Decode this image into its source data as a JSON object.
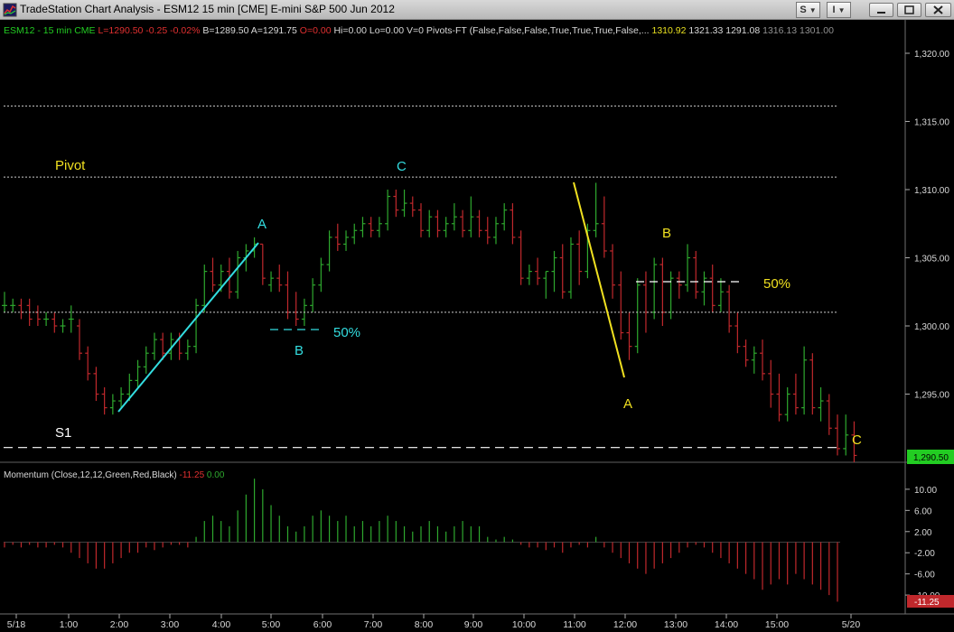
{
  "window": {
    "title": "TradeStation Chart Analysis - ESM12 15 min [CME] E-mini S&P 500 Jun 2012",
    "menu_buttons": [
      {
        "label": "S",
        "icon": "chevron-down-icon"
      },
      {
        "label": "I",
        "icon": "chevron-down-icon"
      }
    ],
    "controls": [
      "minimize-icon",
      "maximize-icon",
      "close-icon"
    ]
  },
  "colors": {
    "background": "#000000",
    "up_bar": "#2ea82e",
    "down_bar": "#c0282c",
    "cyan": "#33dde0",
    "yellow": "#f0e020",
    "axis_text": "#d8d8d8",
    "price_tag": "#22cc22"
  },
  "status_line": [
    {
      "text": "ESM12 - 15 min  CME",
      "color": "#22cc22"
    },
    {
      "text": "L=1290.50",
      "color": "#e03030"
    },
    {
      "text": "-0.25",
      "color": "#e03030"
    },
    {
      "text": "-0.02%",
      "color": "#e03030"
    },
    {
      "text": "B=1289.50",
      "color": "#d8d8d8"
    },
    {
      "text": "A=1291.75",
      "color": "#d8d8d8"
    },
    {
      "text": "O=0.00",
      "color": "#e03030"
    },
    {
      "text": "Hi=0.00",
      "color": "#d8d8d8"
    },
    {
      "text": "Lo=0.00",
      "color": "#d8d8d8"
    },
    {
      "text": "V=0",
      "color": "#d8d8d8"
    },
    {
      "text": "Pivots-FT (False,False,False,True,True,True,False,...",
      "color": "#d8d8d8"
    },
    {
      "text": "1310.92",
      "color": "#e8e020"
    },
    {
      "text": "1321.33",
      "color": "#d8d8d8"
    },
    {
      "text": "1291.08",
      "color": "#d8d8d8"
    },
    {
      "text": "1316.13",
      "color": "#909090"
    },
    {
      "text": "1301.00",
      "color": "#909090"
    }
  ],
  "indicator_line": [
    {
      "text": "Momentum (Close,12,12,Green,Red,Black)",
      "color": "#d8d8d8"
    },
    {
      "text": "-11.25",
      "color": "#e03030"
    },
    {
      "text": "0.00",
      "color": "#2ea82e"
    }
  ],
  "chart_data": [
    {
      "type": "ohlc",
      "x_ticks": [
        "5/18",
        "1:00",
        "2:00",
        "3:00",
        "4:00",
        "5:00",
        "6:00",
        "7:00",
        "8:00",
        "9:00",
        "10:00",
        "11:00",
        "12:00",
        "13:00",
        "14:00",
        "15:00",
        "5/20"
      ],
      "y_ticks": [
        "1,320.00",
        "1,315.00",
        "1,310.00",
        "1,305.00",
        "1,300.00",
        "1,295.00"
      ],
      "ylim": [
        1288,
        1323
      ],
      "last_price": "1,290.50",
      "bars": [
        [
          1301.5,
          1302.5,
          1301,
          1301.5
        ],
        [
          1301.5,
          1302,
          1301,
          1301.5
        ],
        [
          1301.5,
          1302,
          1300.5,
          1301
        ],
        [
          1301.5,
          1302,
          1300,
          1300.5
        ],
        [
          1301,
          1301.5,
          1300,
          1300.5
        ],
        [
          1300.5,
          1301,
          1300,
          1300.5
        ],
        [
          1300.5,
          1301,
          1299.5,
          1300
        ],
        [
          1300,
          1300.5,
          1299.5,
          1300
        ],
        [
          1300.5,
          1301.5,
          1299.5,
          1300.5
        ],
        [
          1300,
          1300.5,
          1297.5,
          1298
        ],
        [
          1298,
          1298.5,
          1296,
          1296.5
        ],
        [
          1296.5,
          1297,
          1294.5,
          1295
        ],
        [
          1295,
          1295.5,
          1293.5,
          1294
        ],
        [
          1294,
          1295,
          1293.5,
          1294.5
        ],
        [
          1294.5,
          1295.5,
          1294,
          1295
        ],
        [
          1295,
          1296.5,
          1294.5,
          1296
        ],
        [
          1296,
          1297.5,
          1295.5,
          1297
        ],
        [
          1297,
          1298.5,
          1296.5,
          1298
        ],
        [
          1298,
          1299.5,
          1297.5,
          1299
        ],
        [
          1299,
          1299.5,
          1297.5,
          1298
        ],
        [
          1298,
          1299.5,
          1297.5,
          1299
        ],
        [
          1299,
          1299.5,
          1297.5,
          1298
        ],
        [
          1298,
          1299,
          1297.5,
          1298.5
        ],
        [
          1298.5,
          1302,
          1298,
          1301.5
        ],
        [
          1301.5,
          1304.5,
          1301,
          1304
        ],
        [
          1304,
          1305,
          1302.5,
          1303
        ],
        [
          1303,
          1304.5,
          1302.5,
          1304
        ],
        [
          1304,
          1305,
          1302,
          1302.5
        ],
        [
          1302.5,
          1305.5,
          1302,
          1305
        ],
        [
          1305,
          1306,
          1304,
          1305.5
        ],
        [
          1305.5,
          1306.5,
          1305,
          1306
        ],
        [
          1306,
          1306,
          1303,
          1303.5
        ],
        [
          1303,
          1304,
          1302.5,
          1303.5
        ],
        [
          1303.5,
          1304.5,
          1302.5,
          1303
        ],
        [
          1303,
          1304,
          1300.5,
          1301
        ],
        [
          1301,
          1302.5,
          1300,
          1300.5
        ],
        [
          1300.5,
          1302,
          1300,
          1301.5
        ],
        [
          1301.5,
          1303.5,
          1301,
          1303
        ],
        [
          1303,
          1305,
          1302.5,
          1304.5
        ],
        [
          1304.5,
          1307,
          1304,
          1306.5
        ],
        [
          1306.5,
          1307.5,
          1305.5,
          1306
        ],
        [
          1306,
          1307,
          1305.5,
          1306.5
        ],
        [
          1306.5,
          1307.5,
          1306,
          1307
        ],
        [
          1307,
          1308,
          1306.5,
          1307.5
        ],
        [
          1307.5,
          1308,
          1306.5,
          1307
        ],
        [
          1307,
          1308,
          1306.5,
          1307.5
        ],
        [
          1307.5,
          1310,
          1307,
          1309.5
        ],
        [
          1309.5,
          1310,
          1308,
          1308.5
        ],
        [
          1308.5,
          1310,
          1308,
          1309
        ],
        [
          1309,
          1309.5,
          1308,
          1308.5
        ],
        [
          1308.5,
          1309,
          1306.5,
          1307
        ],
        [
          1307,
          1308.5,
          1306.5,
          1308
        ],
        [
          1308,
          1308.5,
          1306.5,
          1307
        ],
        [
          1307,
          1308,
          1306.5,
          1307.5
        ],
        [
          1307.5,
          1309,
          1307,
          1308
        ],
        [
          1308,
          1308.5,
          1306.5,
          1307
        ],
        [
          1307,
          1309.5,
          1306.5,
          1308
        ],
        [
          1308,
          1308.5,
          1306.5,
          1307
        ],
        [
          1307,
          1308,
          1306,
          1306.5
        ],
        [
          1306.5,
          1308,
          1306,
          1307.5
        ],
        [
          1307.5,
          1309,
          1307,
          1308.5
        ],
        [
          1308.5,
          1309,
          1306,
          1306.5
        ],
        [
          1306.5,
          1307,
          1303,
          1303.5
        ],
        [
          1303.5,
          1304.5,
          1303,
          1304
        ],
        [
          1304,
          1305,
          1303,
          1303.5
        ],
        [
          1303.5,
          1304,
          1302,
          1304
        ],
        [
          1304,
          1305.5,
          1302.5,
          1305
        ],
        [
          1305,
          1306,
          1302,
          1302.5
        ],
        [
          1302.5,
          1306.5,
          1302,
          1306
        ],
        [
          1306,
          1307,
          1303,
          1304
        ],
        [
          1304,
          1307.5,
          1303.5,
          1307
        ],
        [
          1307,
          1310.5,
          1306.5,
          1307.5
        ],
        [
          1307.5,
          1309.5,
          1305,
          1305.5
        ],
        [
          1305.5,
          1306,
          1302,
          1303
        ],
        [
          1303,
          1304,
          1299,
          1299.5
        ],
        [
          1299.5,
          1301,
          1297.5,
          1298.5
        ],
        [
          1298.5,
          1303.5,
          1298,
          1303
        ],
        [
          1303,
          1304,
          1299.5,
          1301
        ],
        [
          1301,
          1305,
          1300.5,
          1304.5
        ],
        [
          1304.5,
          1305,
          1300,
          1301
        ],
        [
          1301,
          1304,
          1300.5,
          1303.5
        ],
        [
          1303.5,
          1304,
          1302,
          1303
        ],
        [
          1303,
          1306,
          1302.5,
          1305
        ],
        [
          1305,
          1305.5,
          1302,
          1302.5
        ],
        [
          1302.5,
          1304,
          1301.5,
          1303.5
        ],
        [
          1303.5,
          1304.5,
          1301,
          1301.5
        ],
        [
          1301.5,
          1303.5,
          1301,
          1302.5
        ],
        [
          1302.5,
          1303,
          1299.5,
          1300
        ],
        [
          1300,
          1301,
          1298,
          1298.5
        ],
        [
          1298.5,
          1299,
          1297,
          1297.5
        ],
        [
          1297.5,
          1298.5,
          1296.5,
          1298
        ],
        [
          1298,
          1299,
          1296,
          1296.5
        ],
        [
          1296.5,
          1297.5,
          1294,
          1295
        ],
        [
          1295,
          1296.5,
          1293,
          1293.5
        ],
        [
          1293.5,
          1295.5,
          1293,
          1295
        ],
        [
          1295,
          1296.5,
          1293.5,
          1294
        ],
        [
          1294,
          1298.5,
          1293.5,
          1297.5
        ],
        [
          1297.5,
          1298,
          1293.5,
          1294
        ],
        [
          1294,
          1295.5,
          1293,
          1294.5
        ],
        [
          1294.5,
          1295,
          1292,
          1292.5
        ],
        [
          1292.5,
          1293.5,
          1290.5,
          1291
        ],
        [
          1291,
          1293.5,
          1290.5,
          1292
        ],
        [
          1292,
          1293,
          1290,
          1290.5
        ]
      ],
      "levels": [
        {
          "value": 1316.13,
          "style": "dotted"
        },
        {
          "value": 1310.92,
          "style": "dotted",
          "label": "Pivot"
        },
        {
          "value": 1301.0,
          "style": "dotted"
        },
        {
          "value": 1291.08,
          "style": "dashed",
          "label": "S1"
        }
      ],
      "annotations": [
        {
          "text": "A",
          "color": "cyan"
        },
        {
          "text": "B",
          "color": "cyan"
        },
        {
          "text": "C",
          "color": "cyan"
        },
        {
          "text": "50%",
          "color": "cyan"
        },
        {
          "text": "A",
          "color": "yellow"
        },
        {
          "text": "B",
          "color": "yellow"
        },
        {
          "text": "C",
          "color": "yellow"
        },
        {
          "text": "50%",
          "color": "yellow"
        }
      ]
    },
    {
      "type": "bar",
      "title": "Momentum (Close,12,12,Green,Red,Black)",
      "y_ticks": [
        "10.00",
        "6.00",
        "2.00",
        "-2.00",
        "-6.00",
        "-10.00"
      ],
      "ylim": [
        -14,
        14
      ],
      "last_value": "-11.25",
      "values": [
        -1,
        -0.5,
        -1,
        -0.5,
        -1,
        -1,
        -0.5,
        -1,
        -2,
        -3,
        -4,
        -5,
        -5,
        -4,
        -3,
        -2,
        -2,
        -1,
        -1.5,
        -1,
        -0.5,
        -0.5,
        -1,
        1,
        4,
        5,
        4,
        3,
        6,
        9,
        12,
        10,
        7,
        5,
        3,
        2,
        3,
        5,
        6,
        5,
        4,
        5,
        3,
        4,
        3,
        4,
        5,
        4,
        3,
        2,
        3,
        4,
        3,
        2,
        3,
        4,
        3,
        3,
        1,
        0.5,
        1,
        0.5,
        -0.5,
        -1,
        -1,
        -1.5,
        -1,
        -2,
        -1,
        -0.5,
        -1,
        1,
        -1,
        -2,
        -3,
        -4,
        -5,
        -6,
        -5,
        -4,
        -3,
        -2,
        -1,
        -0.5,
        -1,
        -2,
        -3,
        -4,
        -5,
        -6,
        -7,
        -9,
        -8,
        -7,
        -8,
        -6,
        -7,
        -8,
        -9,
        -10,
        -11.25
      ]
    }
  ]
}
